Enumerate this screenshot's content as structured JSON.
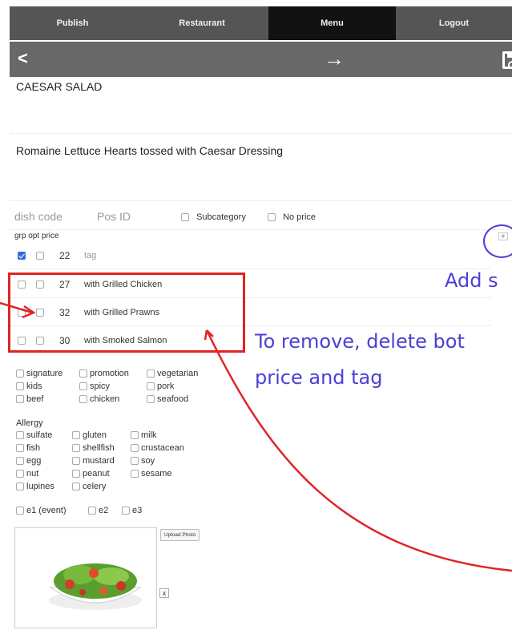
{
  "nav": {
    "tabs": [
      {
        "label": "Publish",
        "active": false
      },
      {
        "label": "Restaurant",
        "active": false
      },
      {
        "label": "Menu",
        "active": true
      },
      {
        "label": "Logout",
        "active": false
      }
    ]
  },
  "subbar": {
    "back_icon": "chevron-left-icon",
    "next_icon": "arrow-right-icon",
    "save_icon": "save-icon"
  },
  "dish": {
    "title": "CAESAR SALAD",
    "description": "Romaine Lettuce Hearts tossed with Caesar Dressing"
  },
  "codes": {
    "dish_code_placeholder": "dish code",
    "pos_id_placeholder": "Pos ID",
    "subcategory_label": "Subcategory",
    "no_price_label": "No price"
  },
  "price_header": "grp opt  price",
  "add_button_label": "+",
  "price_rows": [
    {
      "grp": true,
      "opt": false,
      "price": "22",
      "tag": "tag",
      "tag_is_placeholder": true
    },
    {
      "grp": false,
      "opt": false,
      "price": "27",
      "tag": "with Grilled Chicken",
      "tag_is_placeholder": false
    },
    {
      "grp": false,
      "opt": false,
      "price": "32",
      "tag": "with Grilled Prawns",
      "tag_is_placeholder": false
    },
    {
      "grp": false,
      "opt": false,
      "price": "30",
      "tag": "with Smoked Salmon",
      "tag_is_placeholder": false
    }
  ],
  "annotations": {
    "add": "Add s",
    "remove_line1": "To remove, delete bot",
    "remove_line2": "price and tag",
    "color": "#4b3fd6",
    "box_color": "#e02424"
  },
  "attributes": [
    [
      "signature",
      "promotion",
      "vegetarian"
    ],
    [
      "kids",
      "spicy",
      "pork"
    ],
    [
      "beef",
      "chicken",
      "seafood"
    ]
  ],
  "allergy": {
    "heading": "Allergy",
    "items": [
      [
        "sulfate",
        "gluten",
        "milk"
      ],
      [
        "fish",
        "shellfish",
        "crustacean"
      ],
      [
        "egg",
        "mustard",
        "soy"
      ],
      [
        "nut",
        "peanut",
        "sesame"
      ],
      [
        "lupines",
        "celery"
      ]
    ]
  },
  "events": [
    "e1 (event)",
    "e2",
    "e3"
  ],
  "photo": {
    "upload_label": "Upload Photo",
    "remove_label": "x",
    "image_icon": "salad-photo"
  }
}
